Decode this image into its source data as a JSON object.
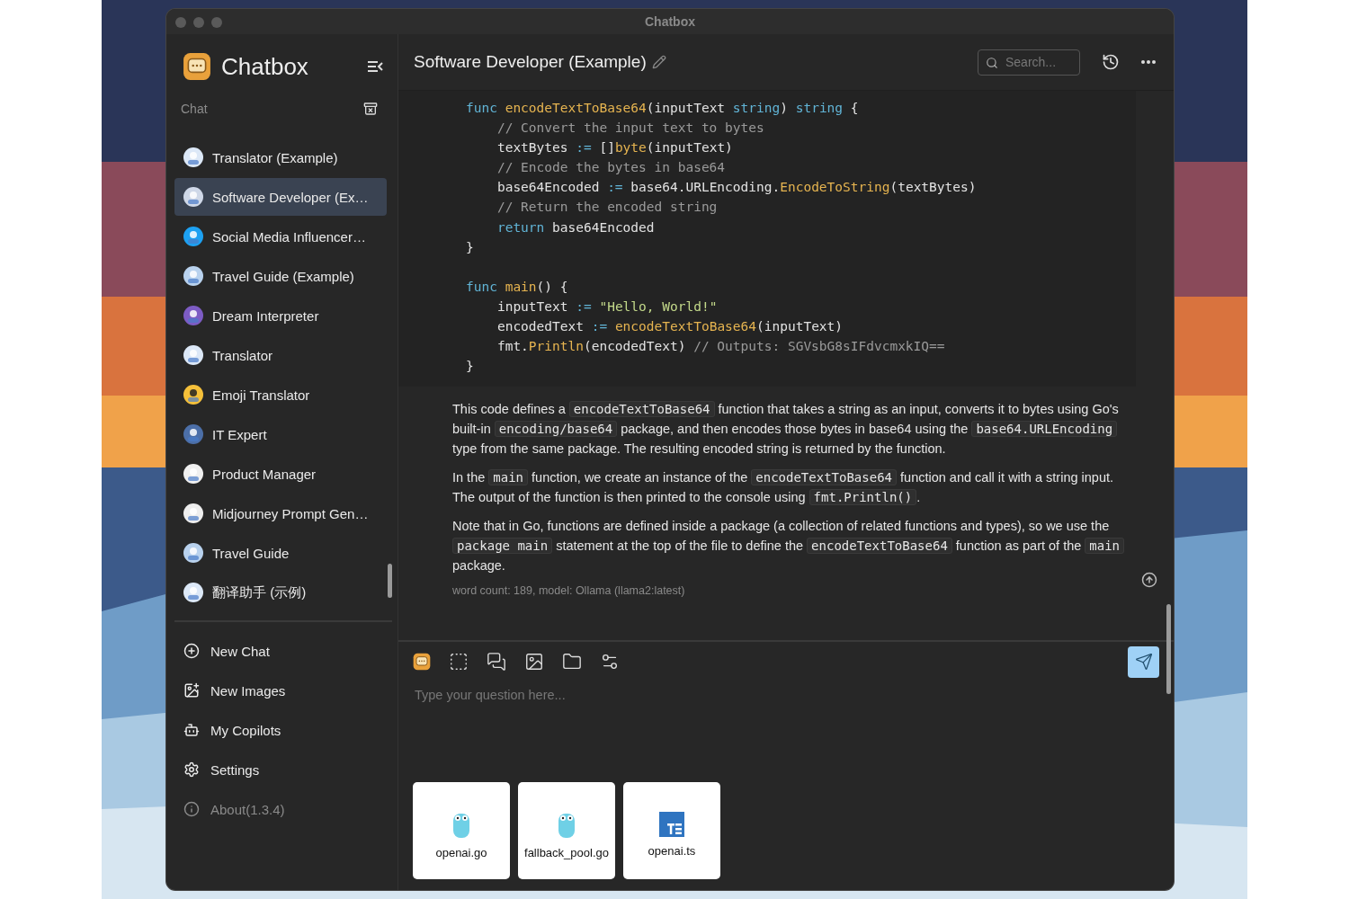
{
  "window": {
    "title": "Chatbox"
  },
  "sidebar": {
    "app_name": "Chatbox",
    "section_label": "Chat",
    "chats": [
      {
        "label": "Translator (Example)",
        "selected": false
      },
      {
        "label": "Software Developer (Ex…",
        "selected": true
      },
      {
        "label": "Social Media Influencer…",
        "selected": false
      },
      {
        "label": "Travel Guide (Example)",
        "selected": false
      },
      {
        "label": "Dream Interpreter",
        "selected": false
      },
      {
        "label": "Translator",
        "selected": false
      },
      {
        "label": "Emoji Translator",
        "selected": false
      },
      {
        "label": "IT Expert",
        "selected": false
      },
      {
        "label": "Product Manager",
        "selected": false
      },
      {
        "label": "Midjourney Prompt Gen…",
        "selected": false
      },
      {
        "label": "Travel Guide",
        "selected": false
      },
      {
        "label": "翻译助手 (示例)",
        "selected": false
      }
    ],
    "menu": [
      {
        "kind": "new-chat",
        "label": "New Chat"
      },
      {
        "kind": "new-images",
        "label": "New Images"
      },
      {
        "kind": "copilots",
        "label": "My Copilots"
      },
      {
        "kind": "settings",
        "label": "Settings"
      },
      {
        "kind": "about",
        "label": "About(1.3.4)"
      }
    ]
  },
  "header": {
    "title": "Software Developer (Example)",
    "search": {
      "placeholder": "Search..."
    }
  },
  "code": {
    "lines": [
      {
        "kind": "code",
        "tokens": [
          {
            "kind": "kw",
            "text": "func "
          },
          {
            "kind": "fn",
            "text": "encodeTextToBase64"
          },
          {
            "kind": "plain",
            "text": "(inputText "
          },
          {
            "kind": "kw",
            "text": "string"
          },
          {
            "kind": "plain",
            "text": ") "
          },
          {
            "kind": "kw",
            "text": "string"
          },
          {
            "kind": "plain",
            "text": " {"
          }
        ]
      },
      {
        "kind": "code",
        "tokens": [
          {
            "kind": "cm",
            "text": "    // Convert the input text to bytes"
          }
        ]
      },
      {
        "kind": "code",
        "tokens": [
          {
            "kind": "plain",
            "text": "    textBytes "
          },
          {
            "kind": "op",
            "text": ":="
          },
          {
            "kind": "plain",
            "text": " []"
          },
          {
            "kind": "fn",
            "text": "byte"
          },
          {
            "kind": "plain",
            "text": "(inputText)"
          }
        ]
      },
      {
        "kind": "code",
        "tokens": [
          {
            "kind": "cm",
            "text": "    // Encode the bytes in base64"
          }
        ]
      },
      {
        "kind": "code",
        "tokens": [
          {
            "kind": "plain",
            "text": "    base64Encoded "
          },
          {
            "kind": "op",
            "text": ":="
          },
          {
            "kind": "plain",
            "text": " base64.URLEncoding."
          },
          {
            "kind": "fn",
            "text": "EncodeToString"
          },
          {
            "kind": "plain",
            "text": "(textBytes)"
          }
        ]
      },
      {
        "kind": "code",
        "tokens": [
          {
            "kind": "cm",
            "text": "    // Return the encoded string"
          }
        ]
      },
      {
        "kind": "code",
        "tokens": [
          {
            "kind": "kw",
            "text": "    return"
          },
          {
            "kind": "plain",
            "text": " base64Encoded"
          }
        ]
      },
      {
        "kind": "code",
        "tokens": [
          {
            "kind": "plain",
            "text": "}"
          }
        ]
      },
      {
        "kind": "blank"
      },
      {
        "kind": "code",
        "tokens": [
          {
            "kind": "kw",
            "text": "func "
          },
          {
            "kind": "fn",
            "text": "main"
          },
          {
            "kind": "plain",
            "text": "() {"
          }
        ]
      },
      {
        "kind": "code",
        "tokens": [
          {
            "kind": "plain",
            "text": "    inputText "
          },
          {
            "kind": "op",
            "text": ":= "
          },
          {
            "kind": "str",
            "text": "\"Hello, World!\""
          }
        ]
      },
      {
        "kind": "code",
        "tokens": [
          {
            "kind": "plain",
            "text": "    encodedText "
          },
          {
            "kind": "op",
            "text": ":= "
          },
          {
            "kind": "fn",
            "text": "encodeTextToBase64"
          },
          {
            "kind": "plain",
            "text": "(inputText)"
          }
        ]
      },
      {
        "kind": "code",
        "tokens": [
          {
            "kind": "plain",
            "text": "    fmt."
          },
          {
            "kind": "fn",
            "text": "Println"
          },
          {
            "kind": "plain",
            "text": "(encodedText) "
          },
          {
            "kind": "cm",
            "text": "// Outputs: SGVsbG8sIFdvcmxkIQ=="
          }
        ]
      },
      {
        "kind": "code",
        "tokens": [
          {
            "kind": "plain",
            "text": "}"
          }
        ]
      }
    ]
  },
  "paragraphs": [
    [
      {
        "kind": "text",
        "text": "This code defines a "
      },
      {
        "kind": "code",
        "text": "encodeTextToBase64"
      },
      {
        "kind": "text",
        "text": " function that takes a string as an input, converts it to bytes using Go's built-in "
      },
      {
        "kind": "code",
        "text": "encoding/base64"
      },
      {
        "kind": "text",
        "text": " package, and then encodes those bytes in base64 using the "
      },
      {
        "kind": "code",
        "text": "base64.URLEncoding"
      },
      {
        "kind": "text",
        "text": " type from the same package. The resulting encoded string is returned by the function."
      }
    ],
    [
      {
        "kind": "text",
        "text": "In the "
      },
      {
        "kind": "code",
        "text": "main"
      },
      {
        "kind": "text",
        "text": " function, we create an instance of the "
      },
      {
        "kind": "code",
        "text": "encodeTextToBase64"
      },
      {
        "kind": "text",
        "text": " function and call it with a string input. The output of the function is then printed to the console using "
      },
      {
        "kind": "code",
        "text": "fmt.Println()"
      },
      {
        "kind": "text",
        "text": "."
      }
    ],
    [
      {
        "kind": "text",
        "text": "Note that in Go, functions are defined inside a package (a collection of related functions and types), so we use the "
      },
      {
        "kind": "code",
        "text": "package main"
      },
      {
        "kind": "text",
        "text": " statement at the top of the file to define the "
      },
      {
        "kind": "code",
        "text": "encodeTextToBase64"
      },
      {
        "kind": "text",
        "text": " function as part of the "
      },
      {
        "kind": "code",
        "text": "main"
      },
      {
        "kind": "text",
        "text": " package."
      }
    ]
  ],
  "message_meta": "word count: 189, model: Ollama (llama2:latest)",
  "composer": {
    "placeholder": "Type your question here...",
    "attachments": [
      {
        "kind": "go",
        "name": "openai.go"
      },
      {
        "kind": "go",
        "name": "fallback_pool.go"
      },
      {
        "kind": "ts",
        "name": "openai.ts"
      }
    ]
  }
}
